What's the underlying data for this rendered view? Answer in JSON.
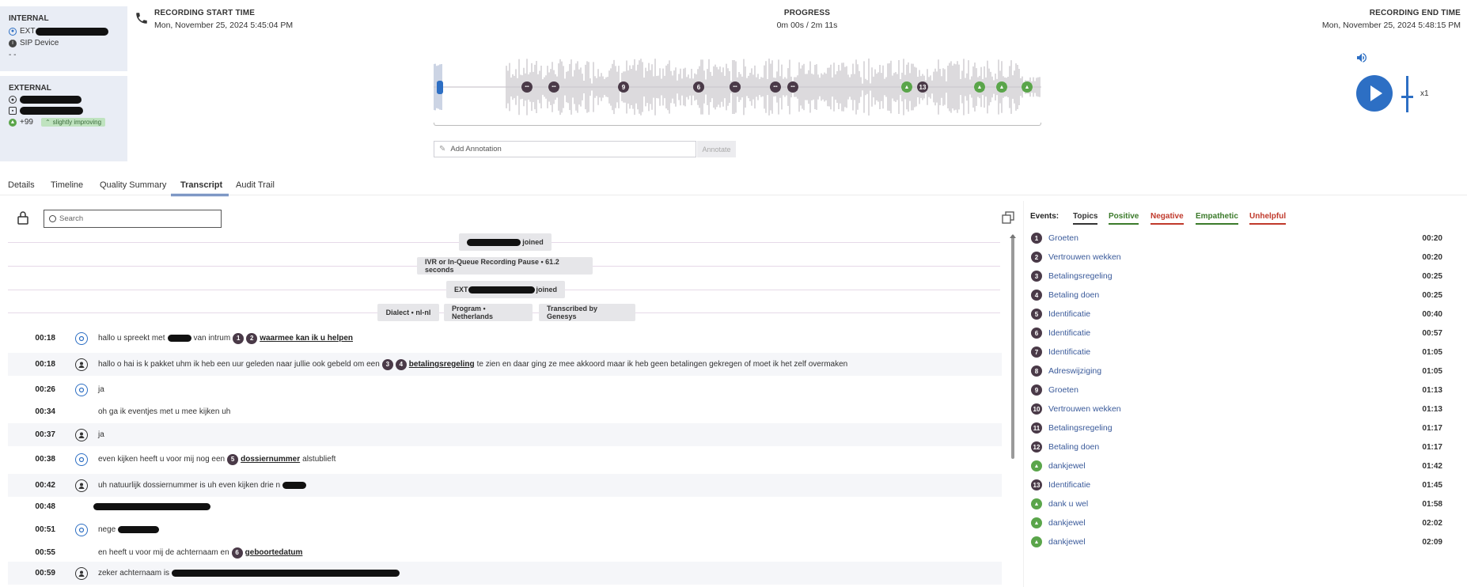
{
  "internal": {
    "title": "INTERNAL",
    "ext_prefix": "EXT",
    "device": "SIP Device",
    "dashes": "- -"
  },
  "external": {
    "title": "EXTERNAL",
    "score": "+99",
    "sentiment": "slightly improving"
  },
  "header": {
    "start_label": "RECORDING START TIME",
    "start_value": "Mon, November 25, 2024 5:45:04 PM",
    "progress_label": "PROGRESS",
    "progress_value": "0m 00s / 2m 11s",
    "end_label": "RECORDING END TIME",
    "end_value": "Mon, November 25, 2024 5:48:15 PM"
  },
  "player": {
    "speed": "x1"
  },
  "annotation": {
    "placeholder": "Add Annotation",
    "button": "Annotate"
  },
  "waveform_markers": [
    {
      "label": "",
      "color": "#4a3a48"
    },
    {
      "label": "",
      "color": "#4a3a48"
    },
    {
      "label": "9",
      "color": "#4a3a48"
    },
    {
      "label": "6",
      "color": "#4a3a48"
    },
    {
      "label": "",
      "color": "#4a3a48"
    },
    {
      "label": "",
      "color": "#4a3a48"
    },
    {
      "label": "",
      "color": "#4a3a48"
    },
    {
      "label": "",
      "color": "#5aa54a"
    },
    {
      "label": "13",
      "color": "#4a3a48"
    },
    {
      "label": "",
      "color": "#5aa54a"
    },
    {
      "label": "",
      "color": "#5aa54a"
    },
    {
      "label": "",
      "color": "#5aa54a"
    }
  ],
  "tabs": [
    "Details",
    "Timeline",
    "Quality Summary",
    "Transcript",
    "Audit Trail"
  ],
  "active_tab": "Transcript",
  "search": {
    "placeholder": "Search"
  },
  "system_pills": {
    "joined1": "joined",
    "pause": "IVR or In-Queue Recording Pause • 61.2 seconds",
    "ext_prefix": "EXT",
    "joined2": "joined",
    "dialect": "Dialect • nl-nl",
    "program": "Program • Netherlands",
    "transcribed": "Transcribed by Genesys"
  },
  "transcript": [
    {
      "time": "00:18",
      "speaker": "agent",
      "t1": "hallo u spreekt met",
      "t2": "van intrum",
      "n1": "1",
      "n2": "2",
      "kw": "waarmee kan ik u helpen"
    },
    {
      "time": "00:18",
      "speaker": "customer",
      "t1": "hallo o hai is k pakket uhm ik heb een uur geleden naar jullie ook gebeld om een",
      "n1": "3",
      "n2": "4",
      "kw": "betalingsregeling",
      "t2": "te zien en daar ging ze mee akkoord maar ik heb geen betalingen gekregen of moet ik het zelf overmaken"
    },
    {
      "time": "00:26",
      "speaker": "agent",
      "t1": "ja"
    },
    {
      "time": "00:34",
      "speaker": "",
      "t1": "oh ga ik eventjes met u mee kijken uh"
    },
    {
      "time": "00:37",
      "speaker": "customer",
      "t1": "ja"
    },
    {
      "time": "00:38",
      "speaker": "agent",
      "t1": "even kijken heeft u voor mij nog een",
      "n1": "5",
      "kw": "dossiernummer",
      "t2": "alstublieft"
    },
    {
      "time": "00:42",
      "speaker": "customer",
      "t1": "uh natuurlijk dossiernummer is uh even kijken drie n"
    },
    {
      "time": "00:48",
      "speaker": "",
      "t1": ""
    },
    {
      "time": "00:51",
      "speaker": "agent",
      "t1": "nege"
    },
    {
      "time": "00:55",
      "speaker": "",
      "t1": "en heeft u voor mij de achternaam en",
      "n1": "6",
      "kw": "geboortedatum"
    },
    {
      "time": "00:59",
      "speaker": "customer",
      "t1": "zeker achternaam is"
    }
  ],
  "events": {
    "label": "Events:",
    "filters": [
      {
        "name": "Topics",
        "color": "#333333"
      },
      {
        "name": "Positive",
        "color": "#3b7a2a"
      },
      {
        "name": "Negative",
        "color": "#c0392b"
      },
      {
        "name": "Empathetic",
        "color": "#3b7a2a"
      },
      {
        "name": "Unhelpful",
        "color": "#c0392b"
      }
    ],
    "items": [
      {
        "n": "1",
        "name": "Groeten",
        "time": "00:20",
        "kind": "topic"
      },
      {
        "n": "2",
        "name": "Vertrouwen wekken",
        "time": "00:20",
        "kind": "topic"
      },
      {
        "n": "3",
        "name": "Betalingsregeling",
        "time": "00:25",
        "kind": "topic"
      },
      {
        "n": "4",
        "name": "Betaling doen",
        "time": "00:25",
        "kind": "topic"
      },
      {
        "n": "5",
        "name": "Identificatie",
        "time": "00:40",
        "kind": "topic"
      },
      {
        "n": "6",
        "name": "Identificatie",
        "time": "00:57",
        "kind": "topic"
      },
      {
        "n": "7",
        "name": "Identificatie",
        "time": "01:05",
        "kind": "topic"
      },
      {
        "n": "8",
        "name": "Adreswijziging",
        "time": "01:05",
        "kind": "topic"
      },
      {
        "n": "9",
        "name": "Groeten",
        "time": "01:13",
        "kind": "topic"
      },
      {
        "n": "10",
        "name": "Vertrouwen wekken",
        "time": "01:13",
        "kind": "topic"
      },
      {
        "n": "11",
        "name": "Betalingsregeling",
        "time": "01:17",
        "kind": "topic"
      },
      {
        "n": "12",
        "name": "Betaling doen",
        "time": "01:17",
        "kind": "topic"
      },
      {
        "n": "",
        "name": "dankjewel",
        "time": "01:42",
        "kind": "positive"
      },
      {
        "n": "13",
        "name": "Identificatie",
        "time": "01:45",
        "kind": "topic"
      },
      {
        "n": "",
        "name": "dank u wel",
        "time": "01:58",
        "kind": "positive"
      },
      {
        "n": "",
        "name": "dankjewel",
        "time": "02:02",
        "kind": "positive"
      },
      {
        "n": "",
        "name": "dankjewel",
        "time": "02:09",
        "kind": "positive"
      }
    ]
  }
}
